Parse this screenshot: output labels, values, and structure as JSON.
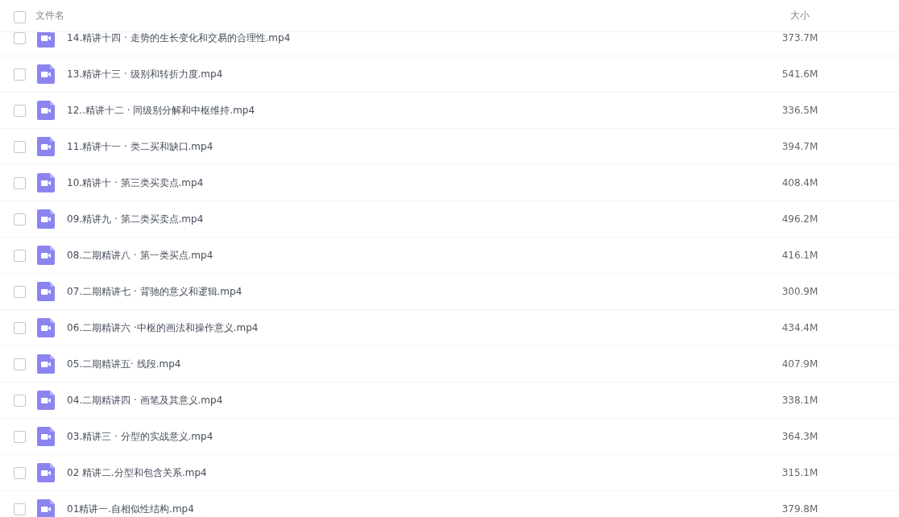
{
  "header": {
    "checked": false,
    "name_column": "文件名",
    "size_column": "大小"
  },
  "files": [
    {
      "name": "14.精讲十四 · 走势的生长变化和交易的合理性.mp4",
      "size": "373.7M",
      "selected": false
    },
    {
      "name": "13.精讲十三 · 级别和转折力度.mp4",
      "size": "541.6M",
      "selected": false
    },
    {
      "name": "12..精讲十二 · 同级别分解和中枢维持.mp4",
      "size": "336.5M",
      "selected": false
    },
    {
      "name": "11.精讲十一 · 类二买和缺口.mp4",
      "size": "394.7M",
      "selected": false
    },
    {
      "name": "10.精讲十 · 第三类买卖点.mp4",
      "size": "408.4M",
      "selected": false
    },
    {
      "name": "09.精讲九 · 第二类买卖点.mp4",
      "size": "496.2M",
      "selected": false
    },
    {
      "name": "08.二期精讲八 · 第一类买点.mp4",
      "size": "416.1M",
      "selected": false
    },
    {
      "name": "07.二期精讲七 · 背驰的意义和逻辑.mp4",
      "size": "300.9M",
      "selected": false
    },
    {
      "name": "06.二期精讲六 ·中枢的画法和操作意义.mp4",
      "size": "434.4M",
      "selected": false
    },
    {
      "name": "05.二期精讲五· 线段.mp4",
      "size": "407.9M",
      "selected": false
    },
    {
      "name": "04.二期精讲四 · 画笔及其意义.mp4",
      "size": "338.1M",
      "selected": false
    },
    {
      "name": "03.精讲三 · 分型的实战意义.mp4",
      "size": "364.3M",
      "selected": false
    },
    {
      "name": "02 精讲二.分型和包含关系.mp4",
      "size": "315.1M",
      "selected": false
    },
    {
      "name": "01精讲一.自相似性结构.mp4",
      "size": "379.8M",
      "selected": false
    }
  ]
}
